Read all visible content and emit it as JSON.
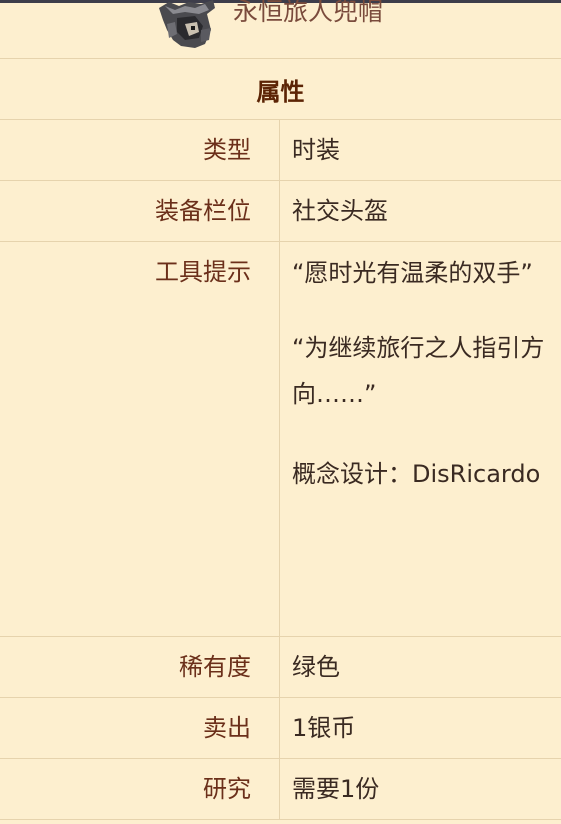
{
  "item": {
    "name": "永恒旅人兜帽",
    "icon": "hood-helmet-icon"
  },
  "section_title": "属性",
  "rows": [
    {
      "key": "类型",
      "value": "时装"
    },
    {
      "key": "装备栏位",
      "value": "社交头盔"
    }
  ],
  "tooltip": {
    "key": "工具提示",
    "line1": "“愿时光有温柔的双手”",
    "line2": "“为继续旅行之人指引方向……”",
    "line3": "概念设计：DisRicardo"
  },
  "rows2": [
    {
      "key": "稀有度",
      "value": "绿色"
    },
    {
      "key": "卖出",
      "value": "1银币"
    },
    {
      "key": "研究",
      "value": "需要1份"
    }
  ],
  "colors": {
    "background": "#fdefcf",
    "key_text": "#6b2f1a",
    "border": "#e6d3ad"
  }
}
